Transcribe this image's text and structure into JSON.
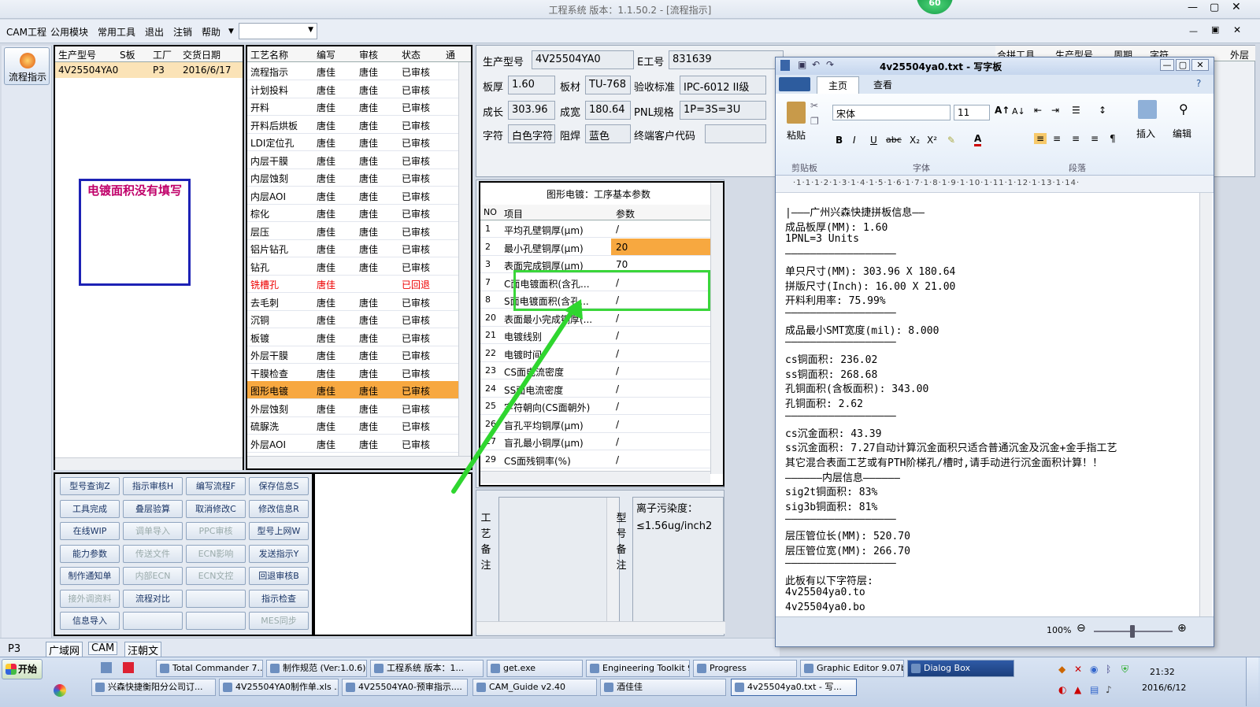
{
  "window": {
    "title": "工程系统  版本：1.1.50.2 - [流程指示]",
    "badge": "60"
  },
  "menu": [
    "CAM工程",
    "公用模块",
    "常用工具",
    "退出",
    "注销",
    "帮助"
  ],
  "flow_button": "流程指示",
  "model_table": {
    "headers": [
      "生产型号",
      "S板",
      "工厂",
      "交货日期"
    ],
    "row": [
      "4V25504YA0",
      "",
      "P3",
      "2016/6/17"
    ]
  },
  "warning_box": "电镀面积没有填写",
  "process_table": {
    "headers": [
      "工艺名称",
      "编写",
      "审核",
      "状态",
      "通"
    ],
    "rows": [
      [
        "流程指示",
        "唐佳",
        "唐佳",
        "已审核"
      ],
      [
        "计划投料",
        "唐佳",
        "唐佳",
        "已审核"
      ],
      [
        "开料",
        "唐佳",
        "唐佳",
        "已审核"
      ],
      [
        "开料后烘板",
        "唐佳",
        "唐佳",
        "已审核"
      ],
      [
        "LDI定位孔",
        "唐佳",
        "唐佳",
        "已审核"
      ],
      [
        "内层干膜",
        "唐佳",
        "唐佳",
        "已审核"
      ],
      [
        "内层蚀刻",
        "唐佳",
        "唐佳",
        "已审核"
      ],
      [
        "内层AOI",
        "唐佳",
        "唐佳",
        "已审核"
      ],
      [
        "棕化",
        "唐佳",
        "唐佳",
        "已审核"
      ],
      [
        "层压",
        "唐佳",
        "唐佳",
        "已审核"
      ],
      [
        "铝片钻孔",
        "唐佳",
        "唐佳",
        "已审核"
      ],
      [
        "钻孔",
        "唐佳",
        "唐佳",
        "已审核"
      ],
      [
        "铣槽孔",
        "唐佳",
        "",
        "已回退"
      ],
      [
        "去毛刺",
        "唐佳",
        "唐佳",
        "已审核"
      ],
      [
        "沉铜",
        "唐佳",
        "唐佳",
        "已审核"
      ],
      [
        "板镀",
        "唐佳",
        "唐佳",
        "已审核"
      ],
      [
        "外层干膜",
        "唐佳",
        "唐佳",
        "已审核"
      ],
      [
        "干膜检查",
        "唐佳",
        "唐佳",
        "已审核"
      ],
      [
        "图形电镀",
        "唐佳",
        "唐佳",
        "已审核"
      ],
      [
        "外层蚀刻",
        "唐佳",
        "唐佳",
        "已审核"
      ],
      [
        "硫脲洗",
        "唐佳",
        "唐佳",
        "已审核"
      ],
      [
        "外层AOI",
        "唐佳",
        "唐佳",
        "已审核"
      ]
    ]
  },
  "buttons": [
    [
      "型号查询Z",
      "指示审核H",
      "编写流程F",
      "保存信息S"
    ],
    [
      "工具完成",
      "叠层验算",
      "取消修改C",
      "修改信息R"
    ],
    [
      "在线WIP",
      "调单导入",
      "PPC审核",
      "型号上网W"
    ],
    [
      "能力参数",
      "传送文件",
      "ECN影响",
      "发送指示Y"
    ],
    [
      "制作通知单",
      "内部ECN",
      "ECN文控",
      "回退审核B"
    ],
    [
      "接外调资料",
      "流程对比",
      "",
      "指示检查"
    ],
    [
      "信息导入",
      "",
      "",
      "MES同步"
    ]
  ],
  "info": {
    "model_label": "生产型号",
    "model": "4V25504YA0",
    "e_label": "E工号",
    "e_no": "831639",
    "thick_label": "板厚",
    "thick": "1.60",
    "mat_label": "板材",
    "mat": "TU-768",
    "std_label": "验收标准",
    "std": "IPC-6012 II级",
    "len_label": "成长",
    "len": "303.96",
    "wid_label": "成宽",
    "wid": "180.64",
    "pnl_label": "PNL规格",
    "pnl": "1P=3S=3U",
    "char_label": "字符",
    "char": "白色字符",
    "mask_label": "阻焊",
    "mask": "蓝色",
    "cust_label": "终端客户代码",
    "cust": ""
  },
  "param_panel": {
    "title": "图形电镀：工序基本参数",
    "headers": [
      "NO",
      "项目",
      "参数"
    ],
    "rows": [
      [
        "1",
        "平均孔壁铜厚(μm)",
        "/"
      ],
      [
        "2",
        "最小孔壁铜厚(μm)",
        "20"
      ],
      [
        "3",
        "表面完成铜厚(μm)",
        "70"
      ],
      [
        "7",
        "C面电镀面积(含孔...",
        "/"
      ],
      [
        "8",
        "S面电镀面积(含孔...",
        "/"
      ],
      [
        "20",
        "表面最小完成铜厚(...",
        "/"
      ],
      [
        "21",
        "电镀线别",
        "/"
      ],
      [
        "22",
        "电镀时间",
        "/"
      ],
      [
        "23",
        "CS面电流密度",
        "/"
      ],
      [
        "24",
        "SS面电流密度",
        "/"
      ],
      [
        "25",
        "字符朝向(CS面朝外)",
        "/"
      ],
      [
        "26",
        "盲孔平均铜厚(μm)",
        "/"
      ],
      [
        "27",
        "盲孔最小铜厚(μm)",
        "/"
      ],
      [
        "29",
        "CS面残铜率(%)",
        "/"
      ]
    ]
  },
  "notes": {
    "process_label": "工艺备注",
    "model_label": "型号备注",
    "ion_text": "离子污染度：≤1.56ug/inch2"
  },
  "status_tabs": [
    "P3",
    "广域网",
    "CAM",
    "汪朝文"
  ],
  "wordpad": {
    "title": "4v25504ya0.txt - 写字板",
    "tabs": [
      "主页",
      "查看"
    ],
    "font": "宋体",
    "size": "11",
    "groups": [
      "剪贴板",
      "字体",
      "段落"
    ],
    "paste": "粘贴",
    "insert": "插入",
    "edit": "编辑",
    "ruler": "·1·1·1·2·1·3·1·4·1·5·1·6·1·7·1·8·1·9·1·10·1·11·1·12·1·13·1·14·",
    "lines": [
      "|———广州兴森快捷拼板信息——",
      "成品板厚(MM): 1.60",
      "1PNL=3 Units",
      "——————————————————",
      "单只尺寸(MM): 303.96 X 180.64",
      "拼版尺寸(Inch): 16.00 X 21.00",
      "开料利用率: 75.99%",
      "——————————————————",
      "成品最小SMT宽度(mil): 8.000",
      "——————————————————",
      "cs铜面积: 236.02",
      "ss铜面积: 268.68",
      "孔铜面积(含板面积): 343.00",
      "孔铜面积: 2.62",
      "——————————————————",
      "cs沉金面积: 43.39",
      "ss沉金面积: 7.27自动计算沉金面积只适合普通沉金及沉金+金手指工艺",
      "其它混合表面工艺或有PTH阶梯孔/槽时,请手动进行沉金面积计算！！",
      "——————内层信息——————",
      "sig2t铜面积: 83%",
      "sig3b铜面积: 81%",
      "——————————————————",
      "层压管位长(MM): 520.70",
      "层压管位宽(MM): 266.70",
      "——————————————————",
      "此板有以下字符层:",
      "4v25504ya0.to",
      "4v25504ya0.bo"
    ],
    "zoom": "100%"
  },
  "behind_headers": [
    "合拼工具",
    "生产型号",
    "周期",
    "字符",
    "外层"
  ],
  "taskbar": {
    "start": "开始",
    "row1": [
      "Total Commander 7....",
      "制作规范 (Ver:1.0.6)",
      "工程系统  版本：1...",
      "get.exe",
      "Engineering Toolkit 9...",
      "Progress",
      "Graphic Editor 9.07b...",
      "Dialog Box"
    ],
    "row2": [
      "兴森快捷衡阳分公司订...",
      "4V25504YA0制作单.xls ...",
      "4V25504YA0-预审指示....",
      "CAM_Guide v2.40",
      "酒佳佳",
      "4v25504ya0.txt - 写..."
    ],
    "time": "21:32",
    "date": "2016/6/12"
  },
  "colors": {
    "accent": "#f7a840",
    "highlight_green": "#3ad63a",
    "warning": "#c0006a"
  }
}
